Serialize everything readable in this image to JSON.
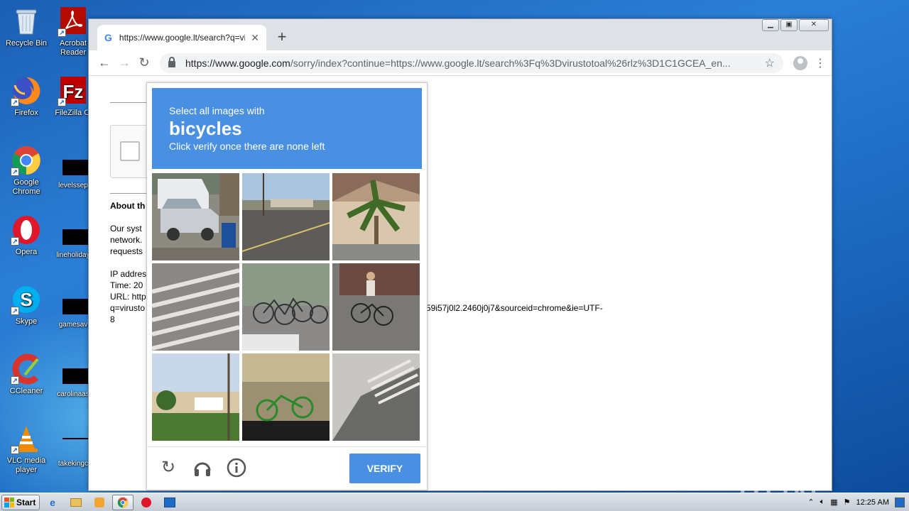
{
  "desktop": {
    "icons": [
      {
        "label": "Recycle Bin"
      },
      {
        "label": "Acrobat Reader"
      },
      {
        "label": "Firefox"
      },
      {
        "label": "FileZilla Cl"
      },
      {
        "label": "Google Chrome"
      },
      {
        "label": "levelssep"
      },
      {
        "label": "Opera"
      },
      {
        "label": "lineholiday"
      },
      {
        "label": "Skype"
      },
      {
        "label": "gamesav"
      },
      {
        "label": "CCleaner"
      },
      {
        "label": "carolinaas"
      },
      {
        "label": "VLC media player"
      },
      {
        "label": "takekingc"
      }
    ],
    "watermark": "ANY  RUN"
  },
  "browser": {
    "tab_title": "https://www.google.lt/search?q=vir",
    "new_tab": "+",
    "url_domain": "https://www.google.com",
    "url_rest": "/sorry/index?continue=https://www.google.lt/search%3Fq%3Dvirustotoal%26rlz%3D1C1GCEA_en...",
    "page": {
      "about_heading": "About th",
      "lines": [
        "Our syst",
        "network.",
        "requests"
      ],
      "info": [
        "IP addres",
        "Time: 20",
        "URL: http",
        "q=virusto",
        "8"
      ],
      "url_tail": "59i57j0l2.2460j0j7&sourceid=chrome&ie=UTF-"
    }
  },
  "captcha": {
    "line1": "Select all images with",
    "keyword": "bicycles",
    "line3": "Click verify once there are none left",
    "verify_label": "Verify",
    "tiles": [
      "cars",
      "street",
      "palm-tree",
      "crosswalk",
      "bicycles",
      "cyclist",
      "houses",
      "bicycle-on-car",
      "sidewalk"
    ]
  },
  "taskbar": {
    "start_label": "Start",
    "clock": "12:25 AM"
  }
}
